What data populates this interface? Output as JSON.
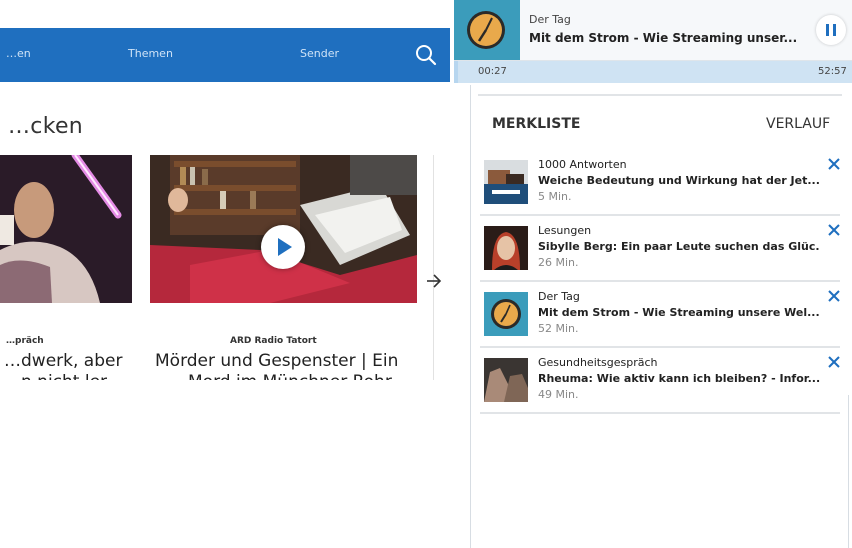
{
  "nav": {
    "items": [
      "…en",
      "Themen",
      "Sender"
    ]
  },
  "section": {
    "title": "…cken"
  },
  "cards": [
    {
      "kicker": "…präch",
      "title_line1": "…dwerk, aber",
      "title_line2": "…n nicht ler…"
    },
    {
      "kicker": "ARD Radio Tatort",
      "title_line1": "Mörder und Gespenster | Ein",
      "title_line2": "Mord im Münchner Rohr…"
    }
  ],
  "player": {
    "label": "Der Tag",
    "title": "Mit dem Strom - Wie Streaming unser...",
    "elapsed": "00:27",
    "duration": "52:57",
    "progress": 0.01
  },
  "tabs": {
    "merkliste": "MERKLISTE",
    "verlauf": "VERLAUF"
  },
  "list": [
    {
      "category": "1000 Antworten",
      "title": "Weiche Bedeutung und Wirkung hat der Jet...",
      "duration": "5 Min.",
      "thumb": "book-stack"
    },
    {
      "category": "Lesungen",
      "title": "Sibylle Berg: Ein paar Leute suchen das Glüc...",
      "duration": "26 Min.",
      "thumb": "portrait-redhead"
    },
    {
      "category": "Der Tag",
      "title": "Mit dem Strom - Wie Streaming unsere Wel...",
      "duration": "52 Min.",
      "thumb": "clock"
    },
    {
      "category": "Gesundheitsgespräch",
      "title": "Rheuma: Wie aktiv kann ich bleiben? - Infor...",
      "duration": "49 Min.",
      "thumb": "hands"
    }
  ],
  "colors": {
    "brand": "#1f6fbf",
    "player_thumb": "#3b9cbb"
  }
}
